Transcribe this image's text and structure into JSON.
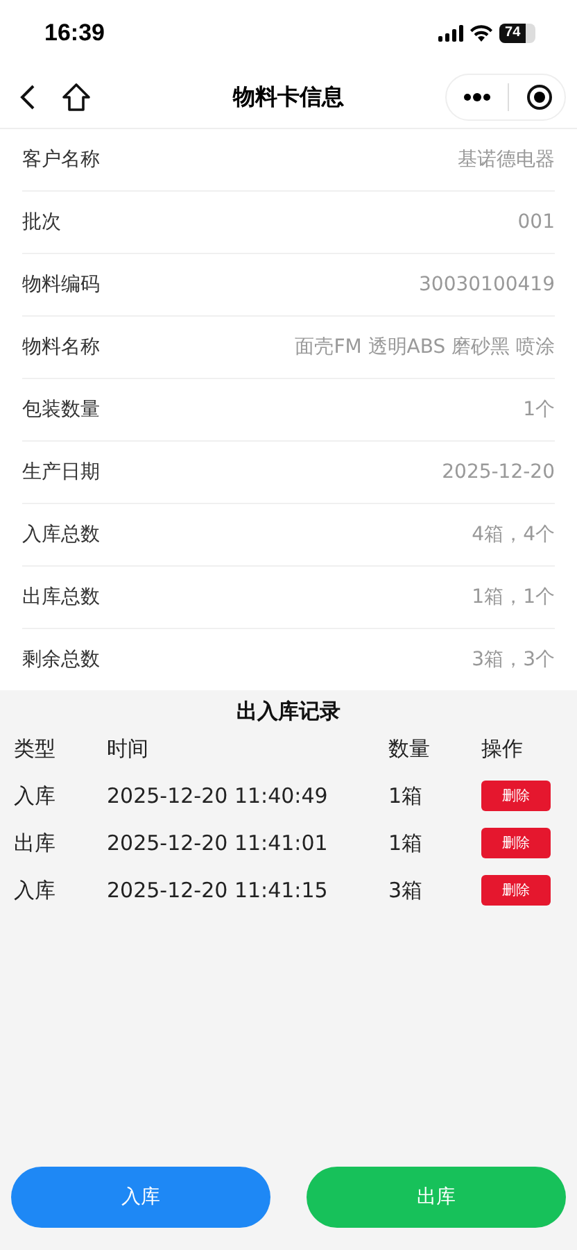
{
  "status_bar": {
    "time": "16:39",
    "battery": "74"
  },
  "nav": {
    "title": "物料卡信息"
  },
  "fields": [
    {
      "label": "客户名称",
      "value": "基诺德电器"
    },
    {
      "label": "批次",
      "value": "001"
    },
    {
      "label": "物料编码",
      "value": "30030100419"
    },
    {
      "label": "物料名称",
      "value": "面壳FM 透明ABS 磨砂黑 喷涂"
    },
    {
      "label": "包装数量",
      "value": "1个"
    },
    {
      "label": "生产日期",
      "value": "2025-12-20"
    },
    {
      "label": "入库总数",
      "value": "4箱，4个"
    },
    {
      "label": "出库总数",
      "value": "1箱，1个"
    },
    {
      "label": "剩余总数",
      "value": "3箱，3个"
    }
  ],
  "records": {
    "title": "出入库记录",
    "columns": [
      "类型",
      "时间",
      "数量",
      "操作"
    ],
    "rows": [
      {
        "type": "入库",
        "time": "2025-12-20 11:40:49",
        "qty": "1箱",
        "action": "删除"
      },
      {
        "type": "出库",
        "time": "2025-12-20 11:41:01",
        "qty": "1箱",
        "action": "删除"
      },
      {
        "type": "入库",
        "time": "2025-12-20 11:41:15",
        "qty": "3箱",
        "action": "删除"
      }
    ]
  },
  "buttons": [
    {
      "label": "入库",
      "kind": "in"
    },
    {
      "label": "出库",
      "kind": "out"
    }
  ]
}
